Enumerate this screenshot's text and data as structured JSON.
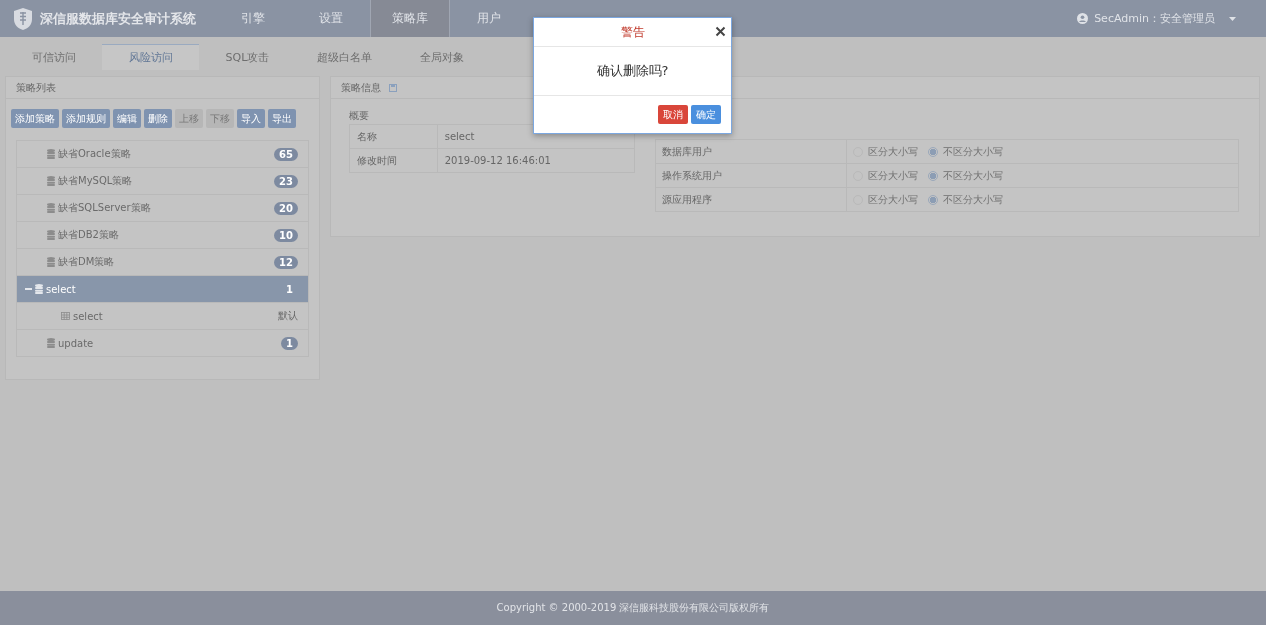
{
  "header": {
    "title": "深信服数据库安全审计系统",
    "nav": [
      {
        "label": "引擎",
        "selected": false
      },
      {
        "label": "设置",
        "selected": false
      },
      {
        "label": "策略库",
        "selected": true
      },
      {
        "label": "用户",
        "selected": false
      }
    ],
    "user": "SecAdmin：安全管理员"
  },
  "tabs": [
    {
      "label": "可信访问",
      "selected": false
    },
    {
      "label": "风险访问",
      "selected": true
    },
    {
      "label": "SQL攻击",
      "selected": false
    },
    {
      "label": "超级白名单",
      "selected": false
    },
    {
      "label": "全局对象",
      "selected": false
    }
  ],
  "policy_list": {
    "title": "策略列表",
    "buttons": [
      {
        "label": "添加策略",
        "disabled": false
      },
      {
        "label": "添加规则",
        "disabled": false
      },
      {
        "label": "编辑",
        "disabled": false
      },
      {
        "label": "删除",
        "disabled": false
      },
      {
        "label": "上移",
        "disabled": true
      },
      {
        "label": "下移",
        "disabled": true
      },
      {
        "label": "导入",
        "disabled": false
      },
      {
        "label": "导出",
        "disabled": false
      }
    ],
    "tree": [
      {
        "kind": "policy",
        "label": "缺省Oracle策略",
        "count": "65",
        "selected": false,
        "expanded": false
      },
      {
        "kind": "policy",
        "label": "缺省MySQL策略",
        "count": "23",
        "selected": false,
        "expanded": false
      },
      {
        "kind": "policy",
        "label": "缺省SQLServer策略",
        "count": "20",
        "selected": false,
        "expanded": false
      },
      {
        "kind": "policy",
        "label": "缺省DB2策略",
        "count": "10",
        "selected": false,
        "expanded": false
      },
      {
        "kind": "policy",
        "label": "缺省DM策略",
        "count": "12",
        "selected": false,
        "expanded": false
      },
      {
        "kind": "policy",
        "label": "select",
        "count": "1",
        "selected": true,
        "expanded": true,
        "children": [
          {
            "kind": "rule",
            "label": "select",
            "tag": "默认",
            "selected": false
          }
        ]
      },
      {
        "kind": "policy",
        "label": "update",
        "count": "1",
        "selected": false,
        "expanded": false
      }
    ]
  },
  "policy_info": {
    "title": "策略信息",
    "summary_label": "概要",
    "summary": [
      {
        "label": "名称",
        "value": "select"
      },
      {
        "label": "修改时间",
        "value": "2019-09-12 16:46:01"
      }
    ],
    "case_rows": [
      {
        "label": "数据库用户",
        "options": [
          {
            "label": "区分大小写",
            "selected": false
          },
          {
            "label": "不区分大小写",
            "selected": true
          }
        ]
      },
      {
        "label": "操作系统用户",
        "options": [
          {
            "label": "区分大小写",
            "selected": false
          },
          {
            "label": "不区分大小写",
            "selected": true
          }
        ]
      },
      {
        "label": "源应用程序",
        "options": [
          {
            "label": "区分大小写",
            "selected": false
          },
          {
            "label": "不区分大小写",
            "selected": true
          }
        ]
      }
    ]
  },
  "footer": "Copyright © 2000-2019 深信服科技股份有限公司版权所有",
  "dialog": {
    "title": "警告",
    "message": "确认删除吗?",
    "buttons": [
      {
        "kind": "cancel",
        "label": "取消"
      },
      {
        "kind": "confirm",
        "label": "确定"
      }
    ]
  }
}
